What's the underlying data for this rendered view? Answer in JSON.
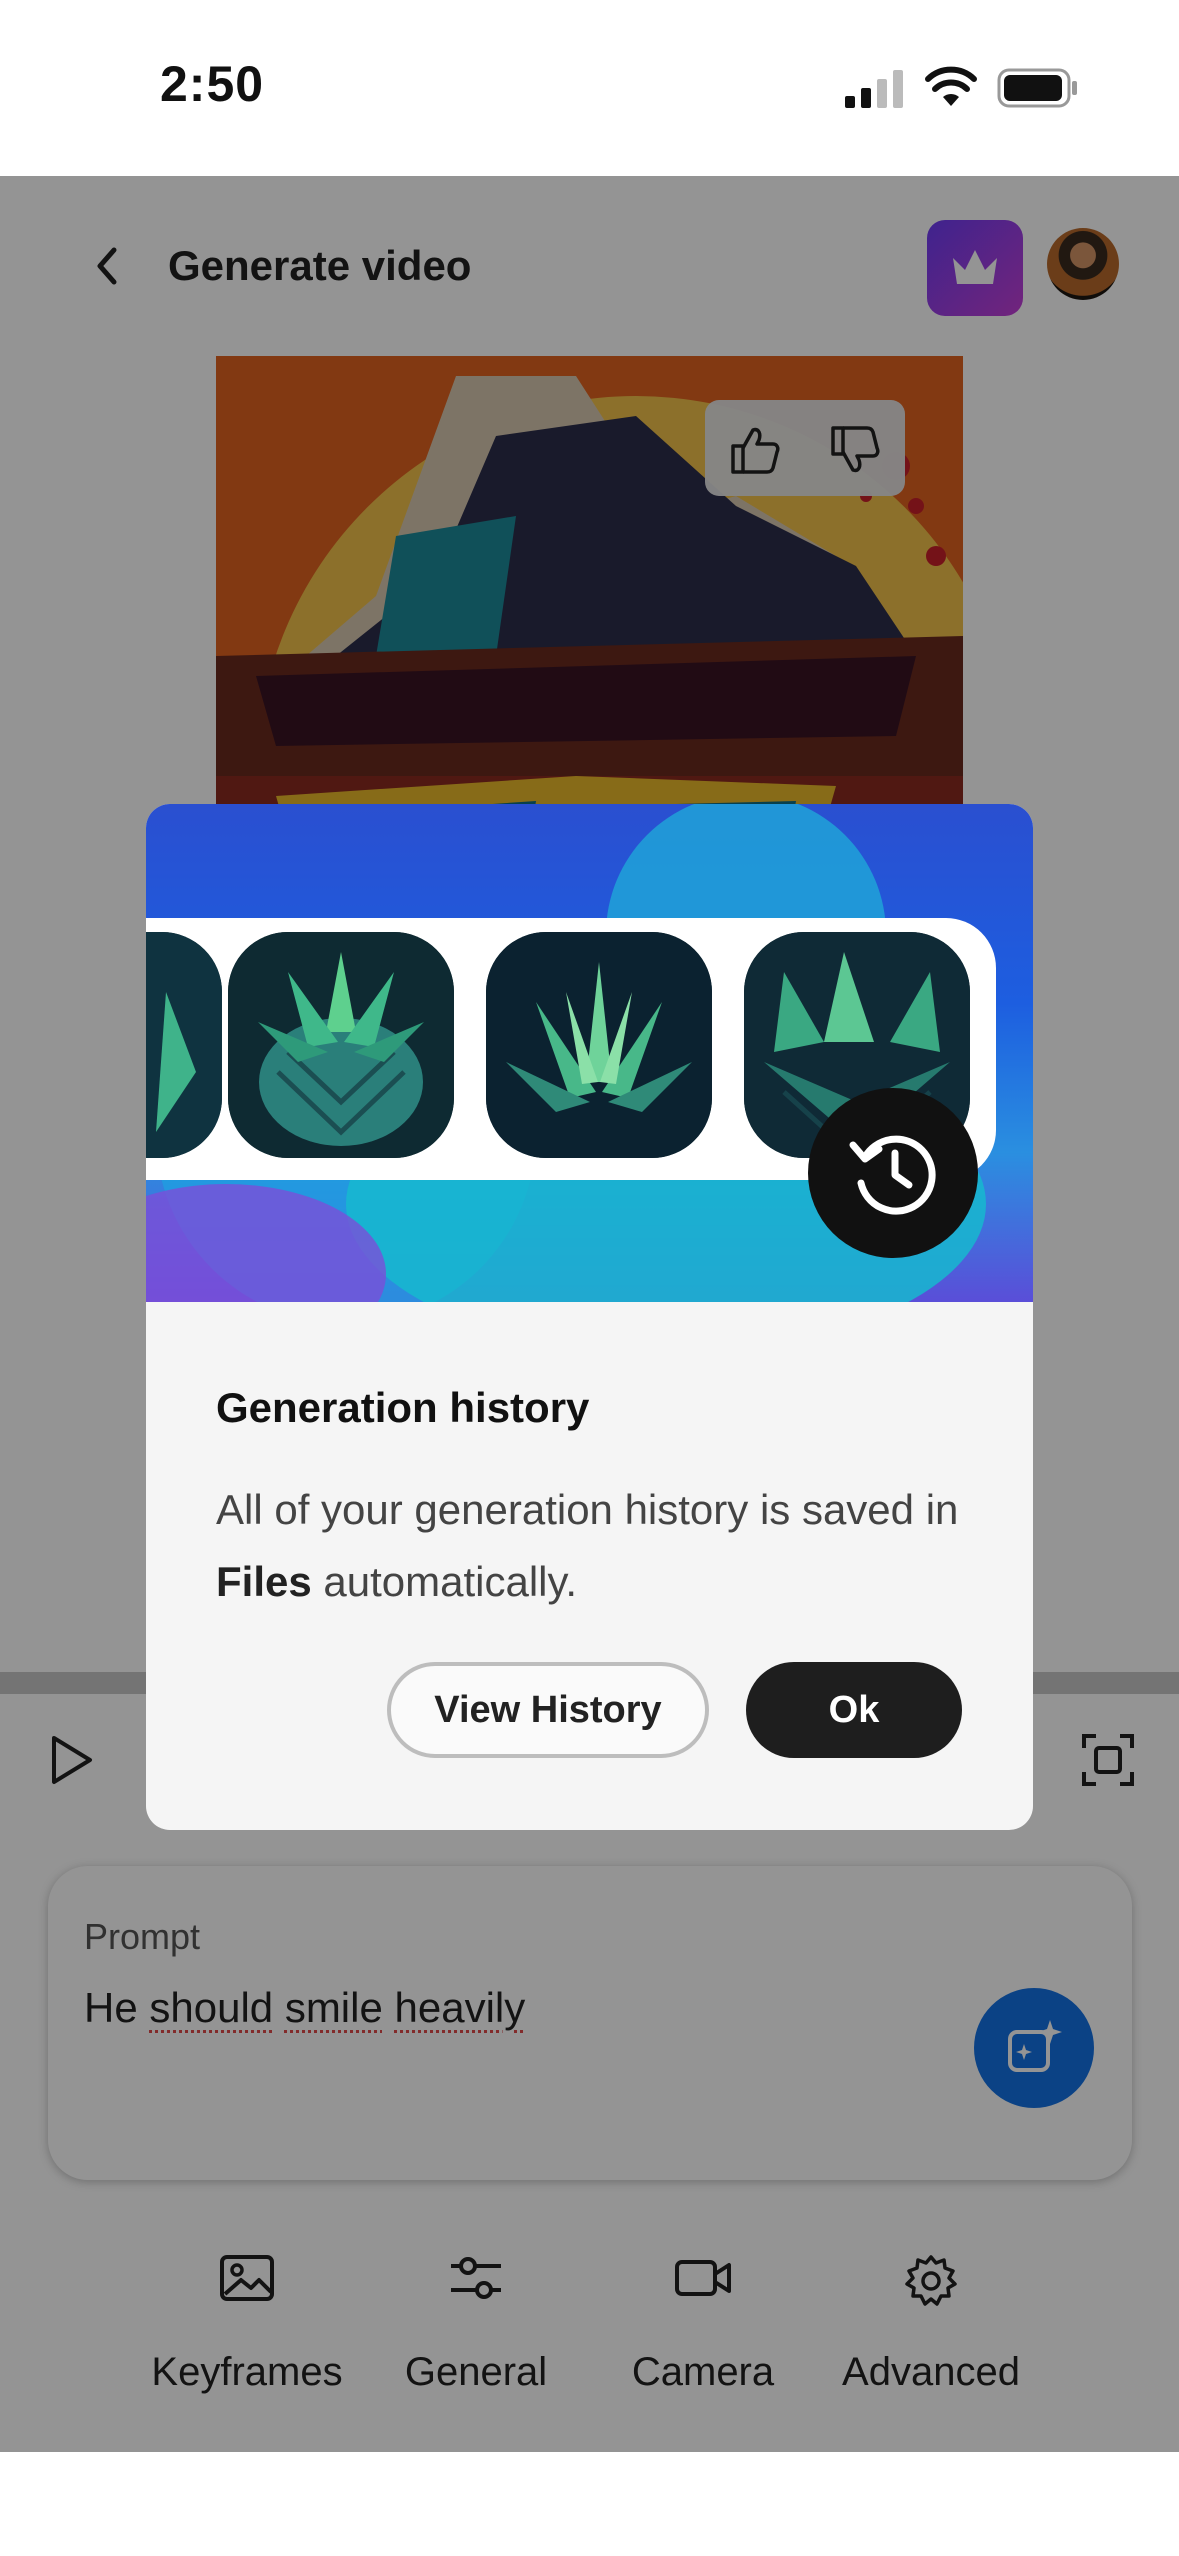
{
  "status_bar": {
    "time": "2:50"
  },
  "header": {
    "title": "Generate video"
  },
  "prompt": {
    "label": "Prompt",
    "words": [
      "He",
      "should",
      "smile",
      "heavily"
    ]
  },
  "toolbar": {
    "items": [
      {
        "label": "Keyframes",
        "icon": "image-icon"
      },
      {
        "label": "General",
        "icon": "sliders-icon"
      },
      {
        "label": "Camera",
        "icon": "video-camera-icon"
      },
      {
        "label": "Advanced",
        "icon": "gear-icon"
      }
    ]
  },
  "modal": {
    "title": "Generation history",
    "body_prefix": "All of your generation history is saved in ",
    "body_bold": "Files",
    "body_suffix": " automatically.",
    "view_history_label": "View History",
    "ok_label": "Ok"
  },
  "colors": {
    "accent_blue": "#1473e6",
    "premium_purple": "#7b3ef0",
    "dark_button": "#1e1e1e"
  }
}
